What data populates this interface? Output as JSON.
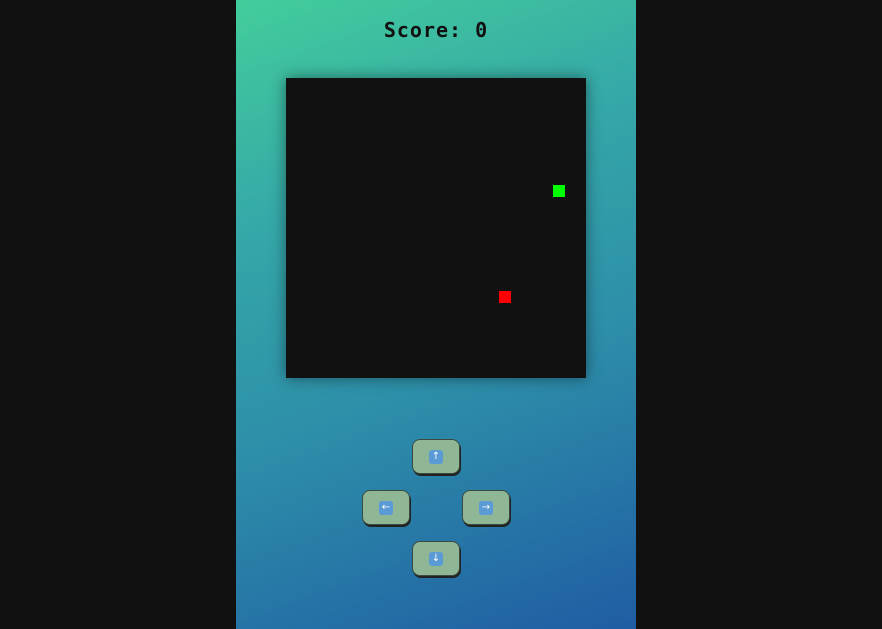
{
  "score": {
    "label": "Score:",
    "value": "0"
  },
  "board": {
    "background": "#111111",
    "snake_color": "#00ff00",
    "food_color": "#ff0000"
  },
  "controls": {
    "up": {
      "glyph": "↑",
      "icon": "arrow-up-icon"
    },
    "left": {
      "glyph": "←",
      "icon": "arrow-left-icon"
    },
    "right": {
      "glyph": "→",
      "icon": "arrow-right-icon"
    },
    "down": {
      "glyph": "↓",
      "icon": "arrow-down-icon"
    }
  }
}
